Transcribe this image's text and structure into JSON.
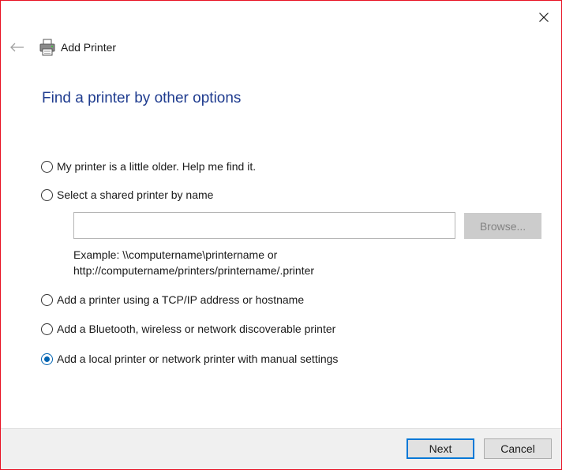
{
  "window": {
    "title": "Add Printer",
    "heading": "Find a printer by other options"
  },
  "icons": {
    "close": "close-icon",
    "back": "back-arrow-icon",
    "printer": "printer-icon"
  },
  "options": [
    {
      "label": "My printer is a little older. Help me find it.",
      "selected": false
    },
    {
      "label": "Select a shared printer by name",
      "selected": false
    },
    {
      "label": "Add a printer using a TCP/IP address or hostname",
      "selected": false
    },
    {
      "label": "Add a Bluetooth, wireless or network discoverable printer",
      "selected": false
    },
    {
      "label": "Add a local printer or network printer with manual settings",
      "selected": true
    }
  ],
  "shared_printer": {
    "input_value": "",
    "browse_label": "Browse...",
    "example_line1": "Example: \\\\computername\\printername or",
    "example_line2": "http://computername/printers/printername/.printer"
  },
  "footer": {
    "next_label": "Next",
    "cancel_label": "Cancel"
  },
  "colors": {
    "heading": "#1f3c8f",
    "accent": "#0078d7",
    "window_border": "#e81123"
  }
}
